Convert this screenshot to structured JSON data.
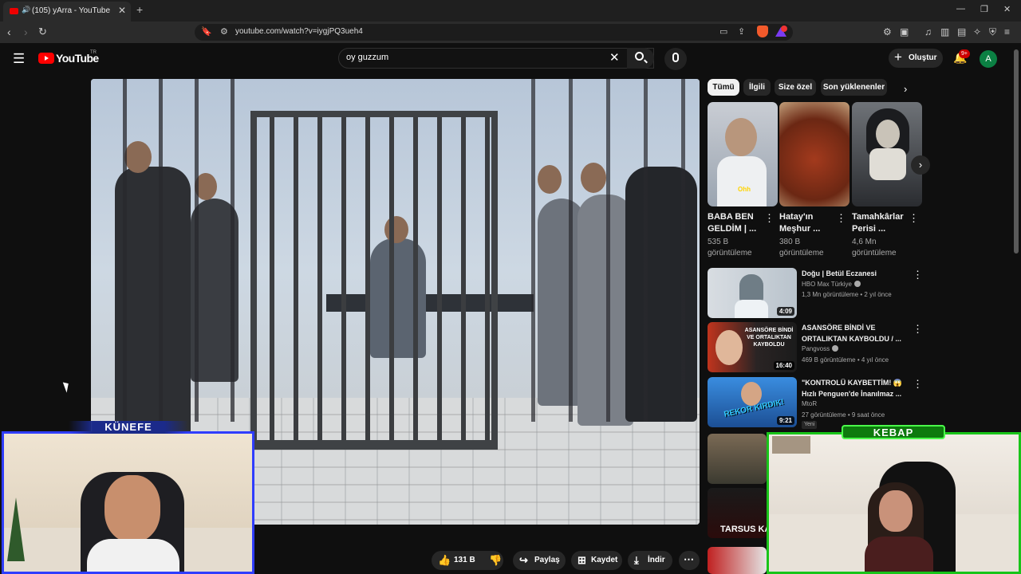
{
  "browser": {
    "tab_title": "(105) yArra - YouTube",
    "url": "youtube.com/watch?v=iygjPQ3ueh4"
  },
  "header": {
    "logo_text": "YouTube",
    "country_code": "TR",
    "search_value": "oy guzzum",
    "create_label": "Oluştur",
    "notification_count": "9+",
    "avatar_letter": "A"
  },
  "actions": {
    "like_count": "131 B",
    "share_label": "Paylaş",
    "save_label": "Kaydet",
    "download_label": "İndir"
  },
  "sidebar": {
    "chips": [
      "Tümü",
      "İlgili",
      "Size özel",
      "Son yüklenenler"
    ],
    "shorts": [
      {
        "title": "BABA BEN GELDİM | ...",
        "views": "535 B görüntüleme",
        "overlay": "Ohh"
      },
      {
        "title": "Hatay'ın Meşhur ...",
        "views": "380 B görüntüleme"
      },
      {
        "title": "Tamahkârlar Perisi ...",
        "views": "4,6 Mn görüntüleme"
      }
    ],
    "recommendations": [
      {
        "title": "Doğu | Betül Eczanesi",
        "channel": "HBO Max Türkiye",
        "meta": "1,3 Mn görüntüleme • 2 yıl önce",
        "duration": "4:09",
        "verified": true
      },
      {
        "title": "ASANSÖRE BİNDİ VE ORTALIKTAN KAYBOLDU / ...",
        "channel": "Pangvoss",
        "meta": "469 B görüntüleme • 4 yıl önce",
        "duration": "16:40",
        "verified": true,
        "thumb_text": "ASANSÖRE BİNDİ VE ORTALIKTAN KAYBOLDU"
      },
      {
        "title": "\"KONTROLÜ KAYBETTİM! 😱 Hızlı Penguen'de İnanılmaz ...",
        "channel": "MtoR",
        "meta": "27 görüntüleme • 9 saat önce",
        "duration": "9:21",
        "badge": "Yeni",
        "thumb_text": "REKOR KIRDIK!"
      }
    ],
    "partial_thumb_text": "TARSUS KA"
  },
  "overlays": {
    "left_cam_label": "KÜNEFE",
    "right_cam_label": "KEBAP"
  },
  "colors": {
    "youtube_red": "#ff0000",
    "left_cam_border": "#2f3dff",
    "right_cam_border": "#19c419"
  }
}
